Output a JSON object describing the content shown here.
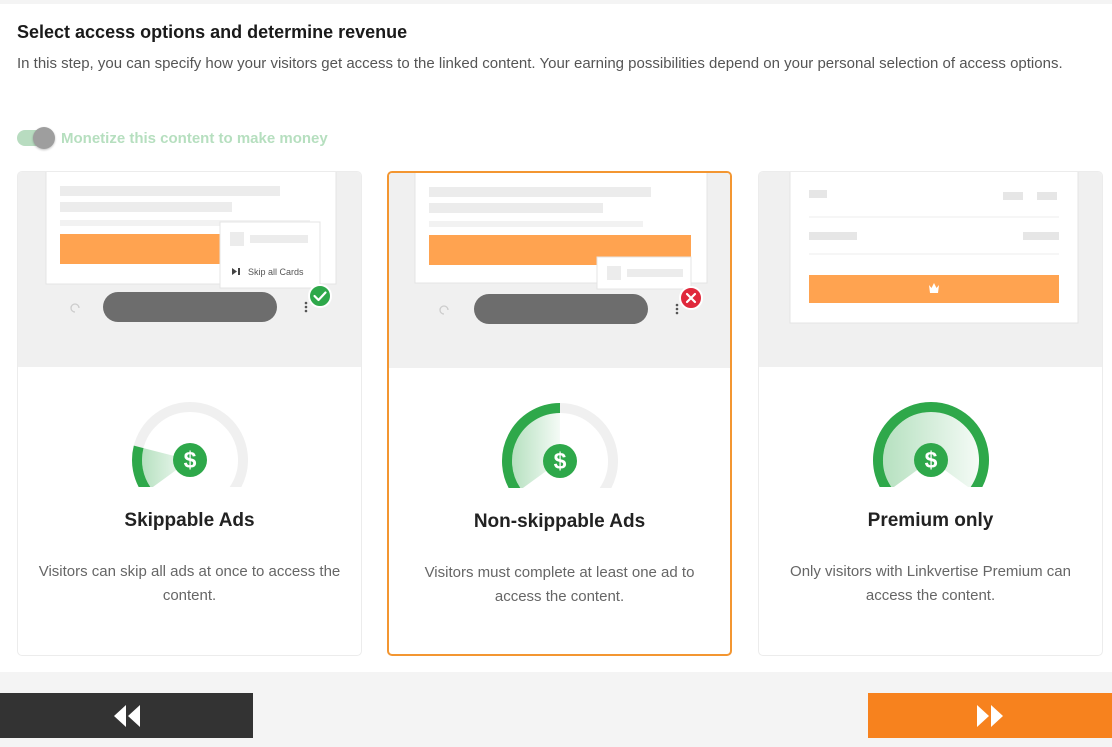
{
  "step": {
    "title": "Select access options and determine revenue",
    "intro": "In this step, you can specify how your visitors get access to the linked content. Your earning possibilities depend on your personal selection of access options."
  },
  "monetize_toggle": {
    "label": "Monetize this content to make money",
    "on": true
  },
  "options": [
    {
      "title": "Skippable Ads",
      "description": "Visitors can skip all ads at once to access the content.",
      "preview_popup_label": "Skip all Cards",
      "allowed": true,
      "selected": false,
      "gauge_level": 0.2
    },
    {
      "title": "Non-skippable Ads",
      "description": "Visitors must complete at least one ad to access the content.",
      "allowed": false,
      "selected": true,
      "gauge_level": 0.5
    },
    {
      "title": "Premium only",
      "description": "Only visitors with Linkvertise Premium can access the content.",
      "selected": false,
      "gauge_level": 1.0
    }
  ],
  "navigation": {
    "back_icon": "rewind-icon",
    "next_icon": "fast-forward-icon"
  },
  "colors": {
    "accent_orange": "#f7821e",
    "orange_bar": "#ffa350",
    "green": "#2ea84a",
    "red": "#e0283c",
    "dark_button": "#333333"
  }
}
